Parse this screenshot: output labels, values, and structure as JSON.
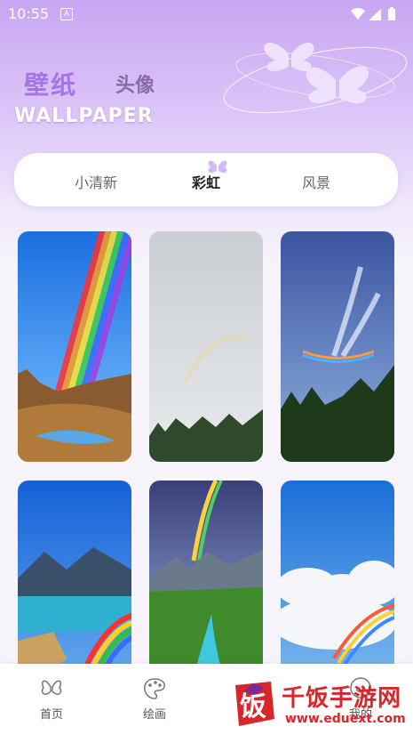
{
  "status_bar": {
    "time": "10:55",
    "notification_glyph": "A"
  },
  "header": {
    "title_main": "壁纸",
    "title_sub": "头像",
    "title_en": "WALLPAPER"
  },
  "tabs": [
    {
      "label": "小清新",
      "active": false
    },
    {
      "label": "彩虹",
      "active": true
    },
    {
      "label": "风景",
      "active": false
    }
  ],
  "wallpapers": [
    {
      "scene": "rainbow over canyon"
    },
    {
      "scene": "faint rainbow in grey sky"
    },
    {
      "scene": "rainbow halo in wispy clouds"
    },
    {
      "scene": "rainbow over mountain lake"
    },
    {
      "scene": "rainbow above valley river"
    },
    {
      "scene": "rainbow over cumulus clouds"
    }
  ],
  "bottom_nav": [
    {
      "label": "首页",
      "icon": "butterfly-icon"
    },
    {
      "label": "绘画",
      "icon": "palette-icon"
    },
    {
      "label": "我的",
      "icon": "user-icon"
    }
  ],
  "watermark": {
    "text_cn": "千饭手游网",
    "url": "www.eduext.com",
    "logo_char": "饭"
  },
  "colors": {
    "accent": "#a674e5",
    "header_top": "#c8a6f2",
    "watermark": "#d8262b"
  }
}
